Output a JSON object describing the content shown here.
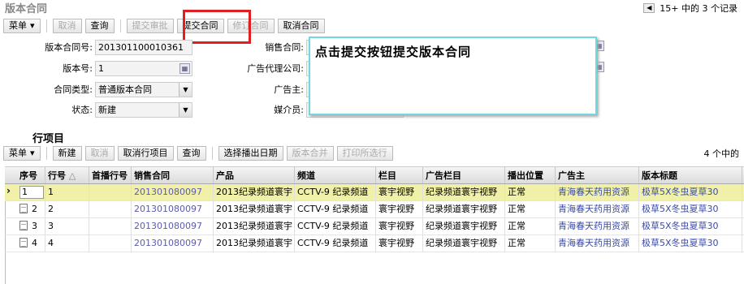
{
  "header": {
    "title": "版本合同",
    "pager_text": "15+ 中的  3 个记录",
    "prev_icon": "◀"
  },
  "toolbar": {
    "menu_label": "菜单",
    "menu_arrow": "▾",
    "cancel_label": "取消",
    "query_label": "查询",
    "submit_approval_label": "提交审批",
    "submit_contract_label": "提交合同",
    "revise_contract_label": "修订合同",
    "cancel_contract_label": "取消合同"
  },
  "form": {
    "contract_no_label": "版本合同号:",
    "contract_no_value": "201301100010361",
    "version_label": "版本号:",
    "version_value": "1",
    "type_label": "合同类型:",
    "type_value": "普通版本合同",
    "status_label": "状态:",
    "status_value": "新建",
    "sales_contract_label": "销售合同:",
    "agency_label": "广告代理公司:",
    "advertiser_label": "广告主:",
    "media_staff_label": "媒介员:"
  },
  "tooltip": {
    "text": "点击提交按钮提交版本合同"
  },
  "lines": {
    "section_title": "行项目",
    "toolbar": {
      "menu_label": "菜单",
      "new_label": "新建",
      "cancel_label": "取消",
      "cancel_line_label": "取消行项目",
      "query_label": "查询",
      "select_date_label": "选择播出日期",
      "merge_version_label": "版本合并",
      "print_selected_label": "打印所选行"
    },
    "count_text": "4 个中的",
    "columns": [
      "序号",
      "行号",
      "首播行号",
      "销售合同",
      "产品",
      "频道",
      "栏目",
      "广告栏目",
      "播出位置",
      "广告主",
      "版本标题"
    ],
    "sort_icon": "△",
    "rows": [
      {
        "seq": "1",
        "line": "1",
        "first": "",
        "sales": "201301080097",
        "product": "2013纪录频道寰宇",
        "channel": "CCTV-9 纪录频道",
        "program": "寰宇视野",
        "ad_program": "纪录频道寰宇视野",
        "position": "正常",
        "advertiser": "青海春天药用资源",
        "version_title": "极草5X冬虫夏草30"
      },
      {
        "seq": "2",
        "line": "2",
        "first": "",
        "sales": "201301080097",
        "product": "2013纪录频道寰宇",
        "channel": "CCTV-9 纪录频道",
        "program": "寰宇视野",
        "ad_program": "纪录频道寰宇视野",
        "position": "正常",
        "advertiser": "青海春天药用资源",
        "version_title": "极草5X冬虫夏草30"
      },
      {
        "seq": "3",
        "line": "3",
        "first": "",
        "sales": "201301080097",
        "product": "2013纪录频道寰宇",
        "channel": "CCTV-9 纪录频道",
        "program": "寰宇视野",
        "ad_program": "纪录频道寰宇视野",
        "position": "正常",
        "advertiser": "青海春天药用资源",
        "version_title": "极草5X冬虫夏草30"
      },
      {
        "seq": "4",
        "line": "4",
        "first": "",
        "sales": "201301080097",
        "product": "2013纪录频道寰宇",
        "channel": "CCTV-9 纪录频道",
        "program": "寰宇视野",
        "ad_program": "纪录频道寰宇视野",
        "position": "正常",
        "advertiser": "青海春天药用资源",
        "version_title": "极草5X冬虫夏草30"
      }
    ],
    "current_row_indicator": "›"
  },
  "colors": {
    "highlight_box": "#e02020",
    "tooltip_border": "#70d8e0",
    "selected_row": "#f0f0a8",
    "link": "#5b5bb0"
  }
}
